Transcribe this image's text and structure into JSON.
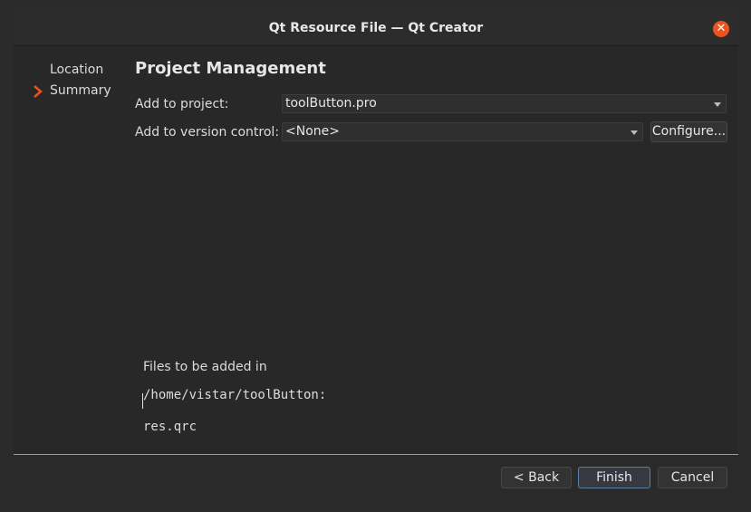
{
  "window": {
    "title": "Qt Resource File — Qt Creator"
  },
  "sidebar": {
    "items": [
      {
        "label": "Location",
        "active": false
      },
      {
        "label": "Summary",
        "active": true
      }
    ]
  },
  "main": {
    "heading": "Project Management",
    "add_to_project": {
      "label": "Add to project:",
      "value": "toolButton.pro"
    },
    "add_to_vc": {
      "label": "Add to version control:",
      "value": "<None>",
      "configure_label": "Configure..."
    },
    "files_heading": "Files to be added in",
    "files_path": "/home/vistar/toolButton:",
    "files": [
      "res.qrc"
    ]
  },
  "footer": {
    "back_label": "< Back",
    "finish_label": "Finish",
    "cancel_label": "Cancel"
  },
  "colors": {
    "accent": "#e95420",
    "default_button_border": "#5e7fa0"
  }
}
